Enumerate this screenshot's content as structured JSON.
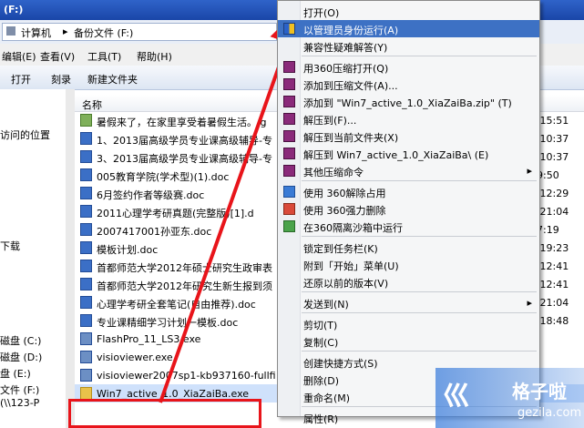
{
  "window": {
    "title": "(F:)"
  },
  "address": {
    "drive_icon": "drive-icon",
    "computer": "计算机",
    "separator": "▸",
    "location": "备份文件 (F:)"
  },
  "menubar": {
    "edit": "编辑(E)",
    "view": "查看(V)",
    "tools": "工具(T)",
    "help": "帮助(H)"
  },
  "toolbar": {
    "open": "打开",
    "burn": "刻录",
    "new_folder": "新建文件夹"
  },
  "navpane": {
    "items": [
      "访问的位置",
      "下载",
      "磁盘 (C:)",
      "磁盘 (D:)",
      "盘 (E:)",
      "文件 (F:)",
      "(\\\\123-P"
    ]
  },
  "filelist": {
    "column_name": "名称",
    "rows": [
      {
        "name": "暑假来了，在家里享受着暑假生活。.g",
        "time": "4 15:51",
        "icon": "img"
      },
      {
        "name": "1、2013届高级学员专业课高级辅导-专",
        "time": "3 10:37",
        "icon": "doc"
      },
      {
        "name": "3、2013届高级学员专业课高级辅导-专",
        "time": "3 10:37",
        "icon": "doc"
      },
      {
        "name": "005教育学院(学术型)(1).doc",
        "time": "19:50",
        "icon": "doc"
      },
      {
        "name": "6月签约作者等级赛.doc",
        "time": "2 12:29",
        "icon": "doc"
      },
      {
        "name": "2011心理学考研真题(完整版)[1].d",
        "time": "5 21:04",
        "icon": "doc"
      },
      {
        "name": "2007417001孙亚东.doc",
        "time": "17:19",
        "icon": "doc"
      },
      {
        "name": "模板计划.doc",
        "time": "5 19:23",
        "icon": "doc"
      },
      {
        "name": "首都师范大学2012年硕士研究生政审表",
        "time": "5 12:41",
        "icon": "doc"
      },
      {
        "name": "首都师范大学2012年研究生新生报到须",
        "time": "5 12:41",
        "icon": "doc"
      },
      {
        "name": "心理学考研全套笔记(自由推荐).doc",
        "time": "5 21:04",
        "icon": "doc"
      },
      {
        "name": "专业课精细学习计划一模板.doc",
        "time": "5 18:48",
        "icon": "doc"
      },
      {
        "name": "FlashPro_11_LS3.exe",
        "time": "",
        "icon": "exe"
      },
      {
        "name": "visioviewer.exe",
        "time": "",
        "icon": "exe"
      },
      {
        "name": "visioviewer2007sp1-kb937160-fullfi",
        "time": "",
        "icon": "exe"
      },
      {
        "name": "Win7_active_1.0_XiaZaiBa.exe",
        "time": "",
        "icon": "zip"
      }
    ]
  },
  "context_menu": {
    "items": [
      {
        "label": "打开(O)",
        "icon": "",
        "arrow": "",
        "highlight": false
      },
      {
        "label": "以管理员身份运行(A)",
        "icon": "shield",
        "arrow": "",
        "highlight": true
      },
      {
        "label": "兼容性疑难解答(Y)",
        "icon": "",
        "arrow": "",
        "highlight": false
      },
      {
        "label": "用360压缩打开(Q)",
        "icon": "winrar",
        "arrow": "",
        "highlight": false
      },
      {
        "label": "添加到压缩文件(A)...",
        "icon": "winrar",
        "arrow": "",
        "highlight": false
      },
      {
        "label": "添加到 \"Win7_active_1.0_XiaZaiBa.zip\" (T)",
        "icon": "winrar",
        "arrow": "",
        "highlight": false
      },
      {
        "label": "解压到(F)...",
        "icon": "winrar",
        "arrow": "",
        "highlight": false
      },
      {
        "label": "解压到当前文件夹(X)",
        "icon": "winrar",
        "arrow": "",
        "highlight": false
      },
      {
        "label": "解压到 Win7_active_1.0_XiaZaiBa\\ (E)",
        "icon": "winrar",
        "arrow": "",
        "highlight": false
      },
      {
        "label": "其他压缩命令",
        "icon": "winrar",
        "arrow": "▸",
        "highlight": false
      },
      {
        "label": "使用 360解除占用",
        "icon": "blue",
        "arrow": "",
        "highlight": false
      },
      {
        "label": "使用 360强力删除",
        "icon": "red",
        "arrow": "",
        "highlight": false
      },
      {
        "label": "在360隔离沙箱中运行",
        "icon": "green",
        "arrow": "",
        "highlight": false
      },
      {
        "label": "锁定到任务栏(K)",
        "icon": "",
        "arrow": "",
        "highlight": false
      },
      {
        "label": "附到「开始」菜单(U)",
        "icon": "",
        "arrow": "",
        "highlight": false
      },
      {
        "label": "还原以前的版本(V)",
        "icon": "",
        "arrow": "",
        "highlight": false
      },
      {
        "label": "发送到(N)",
        "icon": "",
        "arrow": "▸",
        "highlight": false
      },
      {
        "label": "剪切(T)",
        "icon": "",
        "arrow": "",
        "highlight": false
      },
      {
        "label": "复制(C)",
        "icon": "",
        "arrow": "",
        "highlight": false
      },
      {
        "label": "创建快捷方式(S)",
        "icon": "",
        "arrow": "",
        "highlight": false
      },
      {
        "label": "删除(D)",
        "icon": "",
        "arrow": "",
        "highlight": false
      },
      {
        "label": "重命名(M)",
        "icon": "",
        "arrow": "",
        "highlight": false
      },
      {
        "label": "属性(R)",
        "icon": "",
        "arrow": "",
        "highlight": false
      }
    ]
  },
  "watermark": {
    "text": "格子啦",
    "url": "gezila.com",
    "logo": "巛"
  },
  "colors": {
    "accent": "#3d71c4",
    "annotation": "#e8141a",
    "selection": "#cfe1fb"
  }
}
